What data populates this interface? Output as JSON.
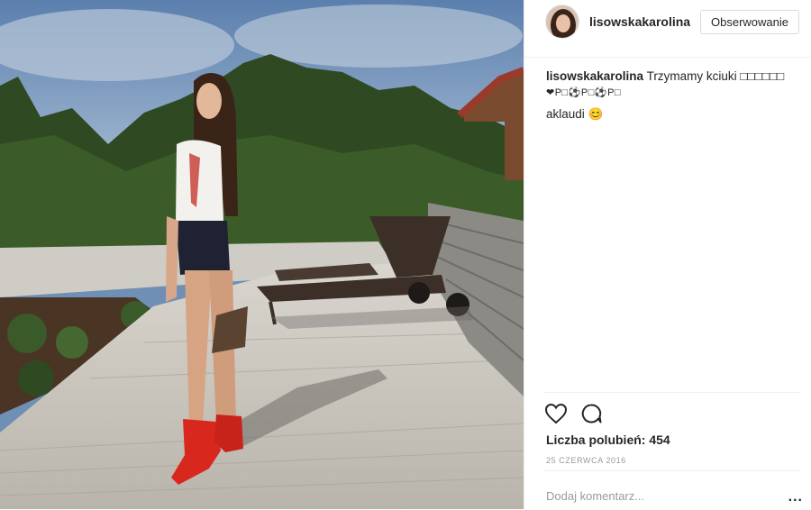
{
  "post": {
    "username": "lisowskakarolina",
    "follow_label": "Obserwowanie",
    "caption_text": "Trzymamy kciuki □□□□□□",
    "caption_line2": "❤P□⚽P□⚽P□",
    "comments": [
      {
        "text": "aklaudi 😊"
      }
    ],
    "likes": "Liczba polubień: 454",
    "date": "25 CZERWCA 2016",
    "comment_placeholder": "Dodaj komentarz...",
    "more_label": "..."
  },
  "icons": [
    "heart-icon",
    "comment-icon",
    "more-icon"
  ],
  "colors": {
    "follow_border": "#dbdbdb",
    "text": "#262626",
    "muted": "#999999"
  }
}
